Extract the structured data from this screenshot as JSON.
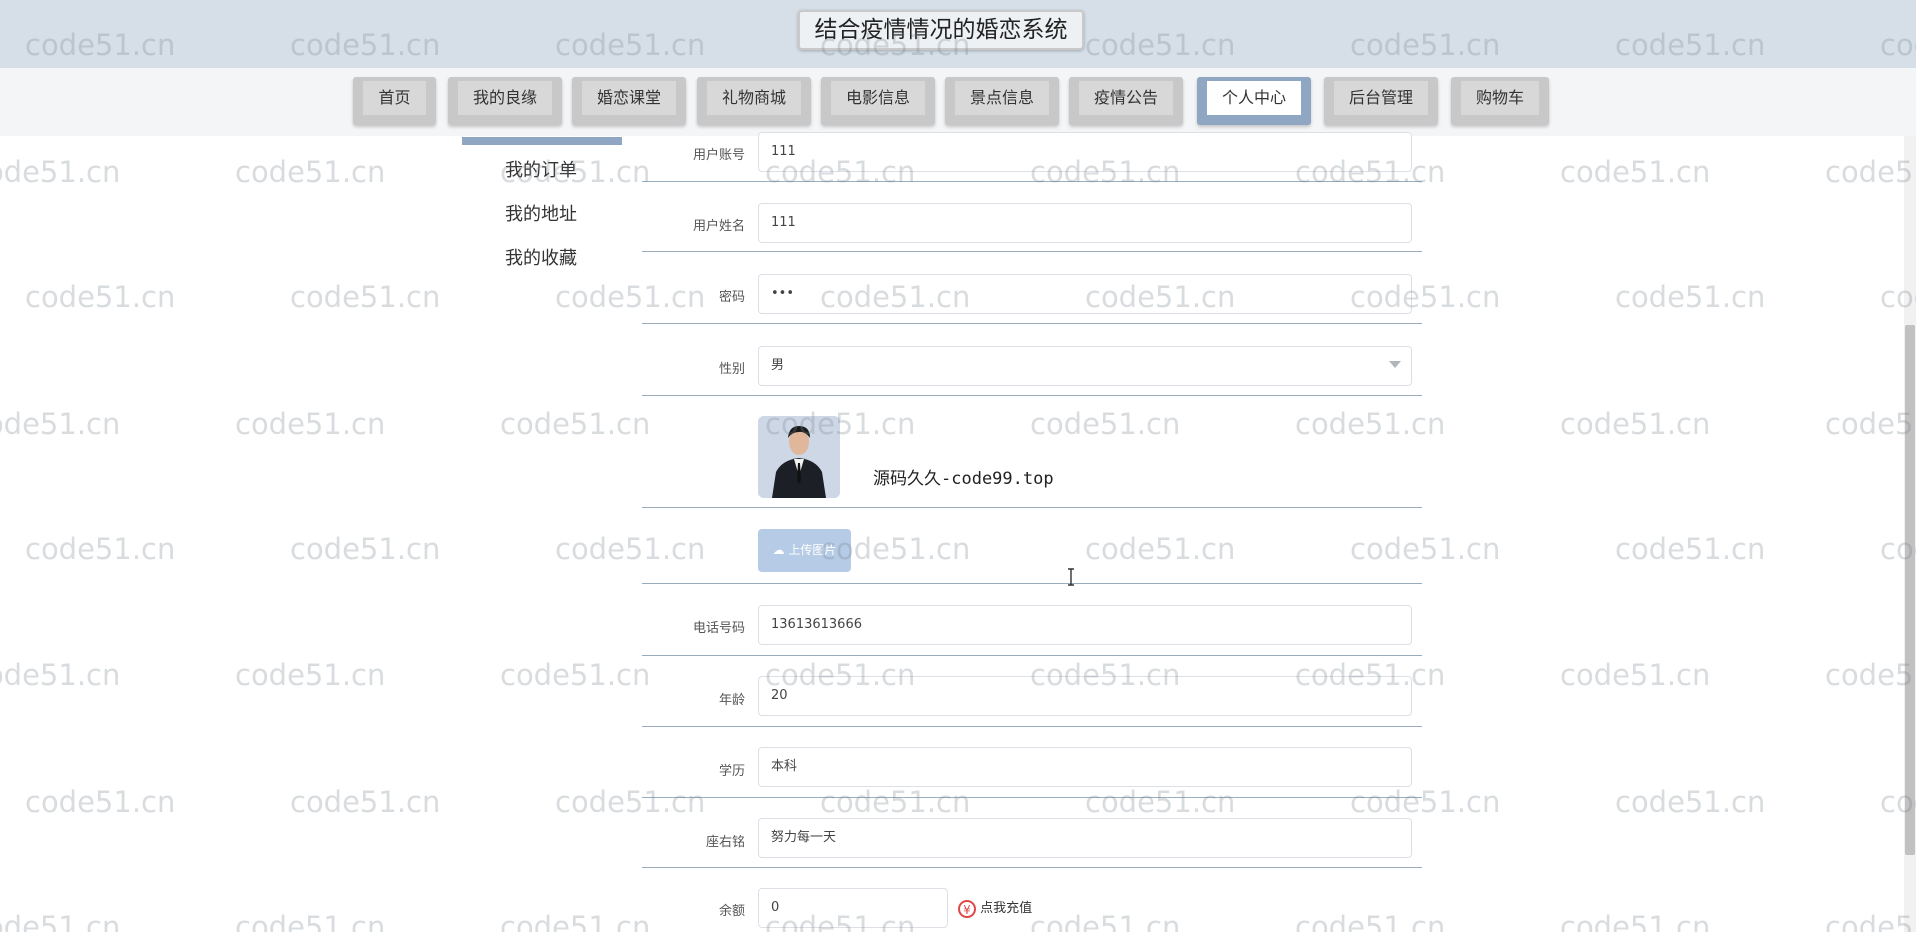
{
  "header": {
    "title": "结合疫情情况的婚恋系统"
  },
  "nav": {
    "items": [
      {
        "label": "首页",
        "active": false
      },
      {
        "label": "我的良缘",
        "active": false
      },
      {
        "label": "婚恋课堂",
        "active": false
      },
      {
        "label": "礼物商城",
        "active": false
      },
      {
        "label": "电影信息",
        "active": false
      },
      {
        "label": "景点信息",
        "active": false
      },
      {
        "label": "疫情公告",
        "active": false
      },
      {
        "label": "个人中心",
        "active": true
      },
      {
        "label": "后台管理",
        "active": false
      },
      {
        "label": "购物车",
        "active": false
      }
    ]
  },
  "sidebar": {
    "links": [
      "我的订单",
      "我的地址",
      "我的收藏"
    ]
  },
  "form": {
    "account_label": "用户账号",
    "account_value": "111",
    "name_label": "用户姓名",
    "name_value": "111",
    "password_label": "密码",
    "password_value": "•••",
    "gender_label": "性别",
    "gender_value": "男",
    "avatar_caption": "源码久久-code99.top",
    "upload_label": "上传图片",
    "phone_label": "电话号码",
    "phone_value": "13613613666",
    "age_label": "年龄",
    "age_value": "20",
    "education_label": "学历",
    "education_value": "本科",
    "motto_label": "座右铭",
    "motto_value": "努力每一天",
    "balance_label": "余额",
    "balance_value": "0",
    "recharge_label": "点我充值",
    "recharge_icon": "¥"
  },
  "watermark": "code51.cn",
  "colors": {
    "accent": "#8fa7c2",
    "header_bg": "#d6dfe8",
    "upload_bg": "#b6cbe6",
    "recharge_red": "#e04848"
  }
}
